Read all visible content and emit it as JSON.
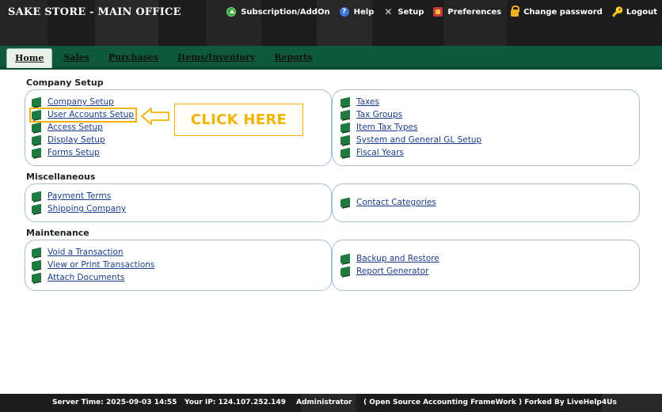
{
  "header": {
    "company": "SAKE STORE - MAIN OFFICE",
    "menu": [
      {
        "icon": "subscription-icon",
        "label": "Subscription/AddOn"
      },
      {
        "icon": "help-icon",
        "label": "Help"
      },
      {
        "icon": "setup-icon",
        "label": "Setup"
      },
      {
        "icon": "preferences-icon",
        "label": "Preferences"
      },
      {
        "icon": "lock-icon",
        "label": "Change password"
      },
      {
        "icon": "key-icon",
        "label": "Logout"
      }
    ]
  },
  "tabs": [
    {
      "label": "Home",
      "active": true
    },
    {
      "label": "Sales"
    },
    {
      "label": "Purchases"
    },
    {
      "label": "Items/Inventory"
    },
    {
      "label": "Reports"
    }
  ],
  "sections": {
    "company_setup": {
      "title": "Company Setup",
      "left": [
        "Company Setup",
        "User Accounts Setup",
        "Access Setup",
        "Display Setup",
        "Forms Setup"
      ],
      "right": [
        "Taxes",
        "Tax Groups",
        "Item Tax Types",
        "System and General GL Setup",
        "Fiscal Years"
      ]
    },
    "misc": {
      "title": "Miscellaneous",
      "left": [
        "Payment Terms",
        "Shipping Company"
      ],
      "right": [
        "Contact Categories"
      ]
    },
    "maintenance": {
      "title": "Maintenance",
      "left": [
        "Void a Transaction",
        "View or Print Transactions",
        "Attach Documents"
      ],
      "right": [
        "Backup and Restore",
        "Report Generator"
      ]
    }
  },
  "annotation": {
    "callout_text": "CLICK HERE",
    "accent": "#f2b400"
  },
  "footer": {
    "server_time": "Server Time: 2025-09-03 14:55",
    "ip": "Your IP: 124.107.252.149",
    "user": "Administrator",
    "credit": "( Open Source Accounting FrameWork ) Forked By LiveHelp4Us"
  },
  "colors": {
    "header_bg": "#1c1c1c",
    "tabbar_bg": "#0f5a3c",
    "link": "#1a3d8a",
    "panel_border": "#a9bcd6"
  }
}
